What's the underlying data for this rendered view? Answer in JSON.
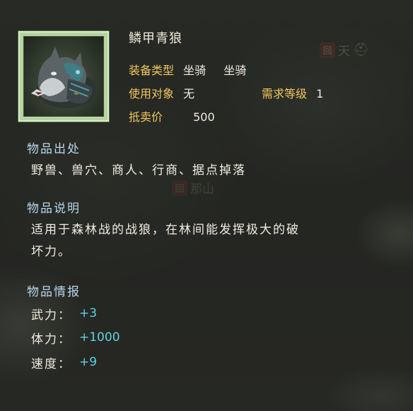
{
  "item": {
    "name": "鳞甲青狼",
    "equip_type_label": "装备类型",
    "equip_type_value_1": "坐骑",
    "equip_type_value_2": "坐骑",
    "use_target_label": "使用对象",
    "use_target_value": "无",
    "required_level_label": "需求等级",
    "required_level_value": "1",
    "sell_price_label": "抵卖价",
    "sell_price_value": "500"
  },
  "source": {
    "heading": "物品出处",
    "text": "野兽、兽穴、商人、行商、据点掉落"
  },
  "description": {
    "heading": "物品说明",
    "line1": "适用于森林战的战狼，在林间能发挥极大的破",
    "line2": "坏力。"
  },
  "stats": {
    "heading": "物品情报",
    "items": [
      {
        "label": "武力：",
        "value": "+3"
      },
      {
        "label": "体力：",
        "value": "+1000"
      },
      {
        "label": "速度：",
        "value": "+9"
      }
    ]
  },
  "background_map": {
    "city_1_badge": "回",
    "city_1_name": "天",
    "city_2_badge": "回",
    "city_2_name": "那山"
  },
  "colors": {
    "label_gold": "#f0c85c",
    "section_heading": "#b8d6ea",
    "stat_value": "#5fd3e0",
    "portrait_frame": "#b7d3a3"
  }
}
